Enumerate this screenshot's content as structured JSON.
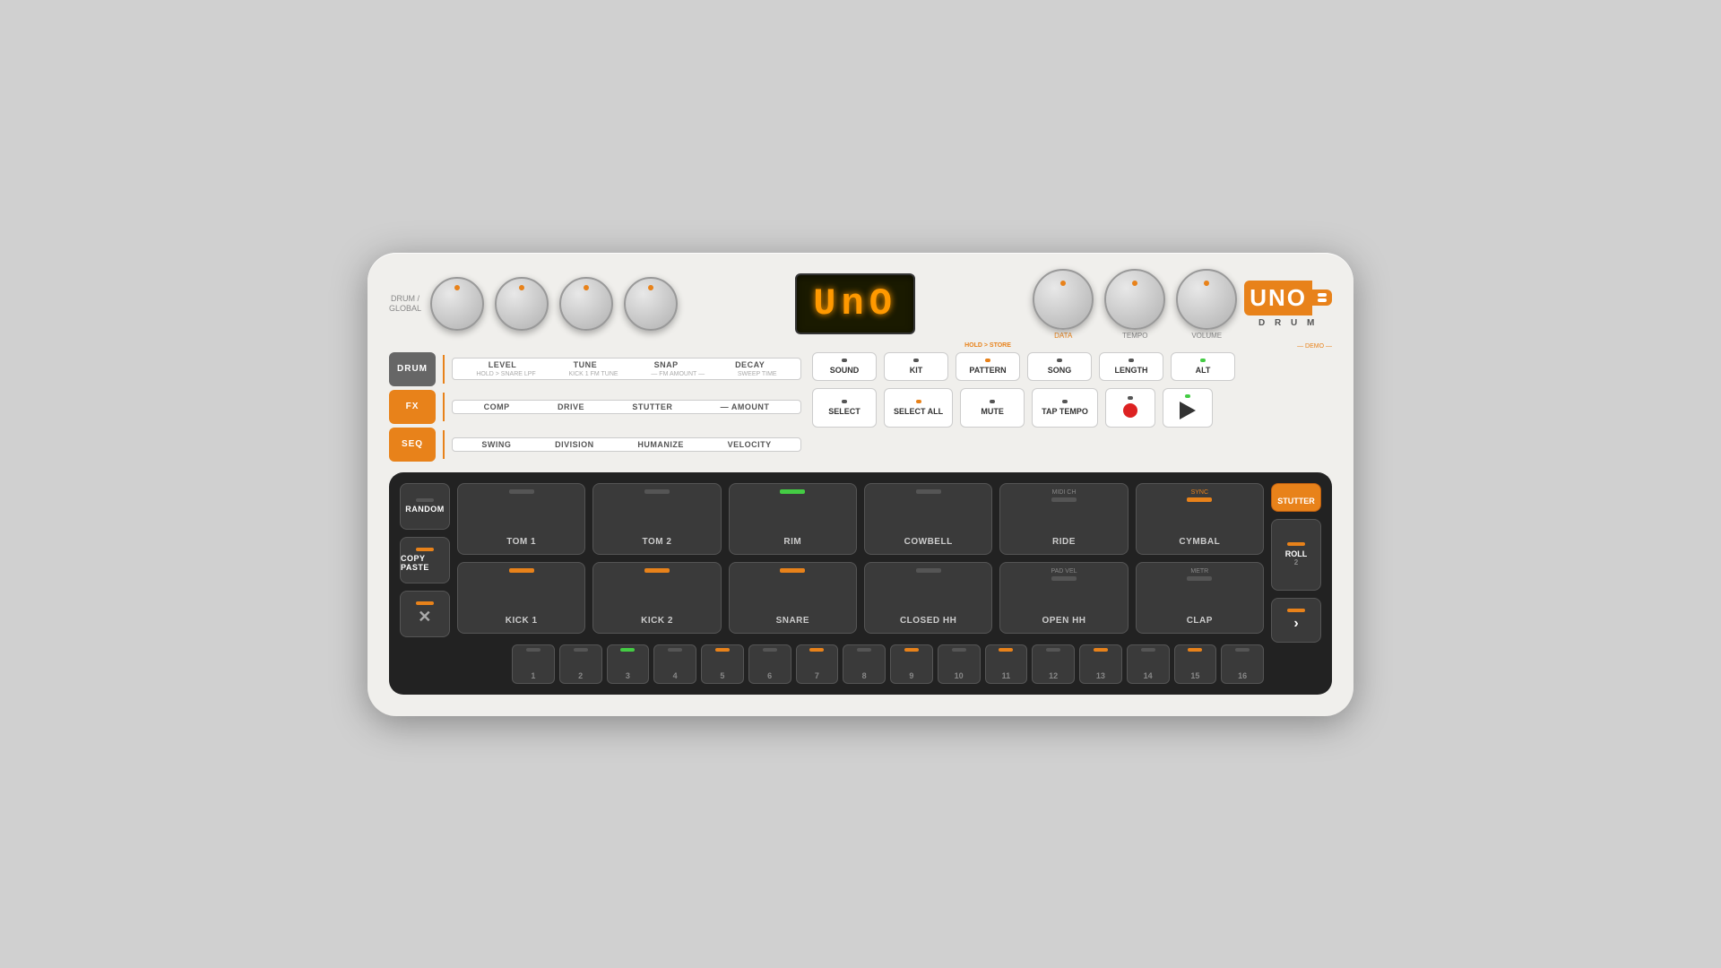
{
  "device": {
    "title": "UNO DRUM",
    "logo_top": "UNO",
    "logo_bottom": "D R U M",
    "display_text": "UnO"
  },
  "knobs": {
    "left": [
      {
        "id": "knob1",
        "pos": "pos1"
      },
      {
        "id": "knob2",
        "pos": "pos2"
      },
      {
        "id": "knob3",
        "pos": "pos3"
      },
      {
        "id": "knob4",
        "pos": "pos4"
      }
    ],
    "drum_global_label": "DRUM / GLOBAL",
    "right": [
      {
        "id": "data",
        "label": "DATA",
        "label_color": "orange"
      },
      {
        "id": "tempo",
        "label": "TEMPO",
        "label_color": "normal"
      },
      {
        "id": "volume",
        "label": "VOLUME",
        "label_color": "normal"
      }
    ]
  },
  "mode_buttons": [
    {
      "id": "drum",
      "label": "DRUM",
      "active": true
    },
    {
      "id": "fx",
      "label": "FX",
      "active": true
    },
    {
      "id": "seq",
      "label": "SEQ",
      "active": true
    }
  ],
  "mode_params": {
    "drum": {
      "main": [
        "LEVEL",
        "TUNE",
        "SNAP",
        "DECAY"
      ],
      "sub": [
        "HOLD > SNARE LPF",
        "KICK 1 FM TUNE",
        "— FM AMOUNT —",
        "SWEEP TIME"
      ]
    },
    "fx": {
      "main": [
        "COMP",
        "DRIVE",
        "STUTTER",
        "— AMOUNT"
      ],
      "sub": []
    },
    "seq": {
      "main": [
        "SWING",
        "DIVISION",
        "HUMANIZE",
        "VELOCITY"
      ],
      "sub": []
    }
  },
  "top_buttons_row1": [
    {
      "id": "sound",
      "label": "SOUND",
      "led": "off"
    },
    {
      "id": "kit",
      "label": "KIT",
      "led": "off"
    },
    {
      "id": "pattern",
      "label": "PATTERN",
      "led": "off",
      "hold_store": true
    },
    {
      "id": "song",
      "label": "SONG",
      "led": "off"
    },
    {
      "id": "length",
      "label": "LENGTH",
      "led": "off"
    },
    {
      "id": "alt",
      "label": "ALT",
      "led": "green",
      "demo": true
    }
  ],
  "top_buttons_row2": [
    {
      "id": "select",
      "label": "SELECT",
      "led": "off"
    },
    {
      "id": "select_all",
      "label": "SELECT ALL",
      "led": "orange"
    },
    {
      "id": "mute",
      "label": "MUTE",
      "led": "off"
    },
    {
      "id": "tap_tempo",
      "label": "TAP TEMPO",
      "led": "off"
    },
    {
      "id": "record",
      "type": "record",
      "led": "off"
    },
    {
      "id": "play",
      "type": "play",
      "led": "off"
    }
  ],
  "side_buttons_left": [
    {
      "id": "random",
      "label": "RANDOM",
      "style": "normal",
      "led": "off"
    },
    {
      "id": "copy_paste",
      "label": "COPY PASTE",
      "style": "normal",
      "led": "orange"
    },
    {
      "id": "cancel",
      "label": "X",
      "style": "normal",
      "led": "orange"
    }
  ],
  "pads_top": [
    {
      "id": "tom1",
      "label": "TOM 1",
      "led": "off",
      "sublabel": ""
    },
    {
      "id": "tom2",
      "label": "TOM 2",
      "led": "off",
      "sublabel": ""
    },
    {
      "id": "rim",
      "label": "RIM",
      "led": "green",
      "sublabel": ""
    },
    {
      "id": "cowbell",
      "label": "COWBELL",
      "led": "off",
      "sublabel": ""
    },
    {
      "id": "ride",
      "label": "RIDE",
      "led": "off",
      "sublabel": "MIDI CH"
    },
    {
      "id": "cymbal",
      "label": "CYMBAL",
      "led": "off",
      "sublabel": "SYNC"
    }
  ],
  "pads_bottom": [
    {
      "id": "kick1",
      "label": "KICK 1",
      "led": "orange",
      "sublabel": ""
    },
    {
      "id": "kick2",
      "label": "KICK 2",
      "led": "orange",
      "sublabel": ""
    },
    {
      "id": "snare",
      "label": "SNARE",
      "led": "orange",
      "sublabel": ""
    },
    {
      "id": "closed_hh",
      "label": "CLOSED HH",
      "led": "off",
      "sublabel": ""
    },
    {
      "id": "open_hh",
      "label": "OPEN HH",
      "led": "off",
      "sublabel": "PAD VEL"
    },
    {
      "id": "clap",
      "label": "CLAP",
      "led": "off",
      "sublabel": "METR"
    }
  ],
  "right_side_buttons": [
    {
      "id": "stutter",
      "label": "STUTTER",
      "style": "orange",
      "led": "orange"
    },
    {
      "id": "roll",
      "label": "ROLL",
      "style": "normal",
      "led": "orange",
      "sublabel": "2"
    },
    {
      "id": "next",
      "label": ">",
      "style": "normal",
      "led": "orange"
    }
  ],
  "step_buttons": [
    {
      "num": "1",
      "led": "off"
    },
    {
      "num": "2",
      "led": "off"
    },
    {
      "num": "3",
      "led": "green"
    },
    {
      "num": "4",
      "led": "off"
    },
    {
      "num": "5",
      "led": "orange"
    },
    {
      "num": "6",
      "led": "off"
    },
    {
      "num": "7",
      "led": "orange"
    },
    {
      "num": "8",
      "led": "off"
    },
    {
      "num": "9",
      "led": "orange"
    },
    {
      "num": "10",
      "led": "off"
    },
    {
      "num": "11",
      "led": "orange"
    },
    {
      "num": "12",
      "led": "off"
    },
    {
      "num": "13",
      "led": "orange"
    },
    {
      "num": "14",
      "led": "off"
    },
    {
      "num": "15",
      "led": "orange"
    },
    {
      "num": "16",
      "led": "off"
    }
  ]
}
